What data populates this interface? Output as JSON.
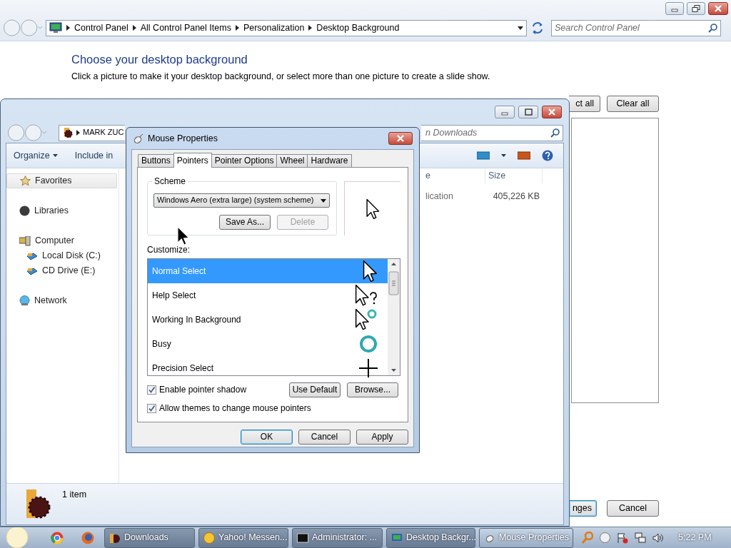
{
  "control_panel": {
    "breadcrumb": [
      "Control Panel",
      "All Control Panel Items",
      "Personalization",
      "Desktop Background"
    ],
    "search": {
      "placeholder": "Search Control Panel"
    },
    "heading": "Choose your desktop background",
    "description": "Click a picture to make it your desktop background, or select more than one picture to create a slide show.",
    "top_buttons": [
      "ct all",
      "Clear all"
    ],
    "bottom_buttons": [
      {
        "label": "nges",
        "default": true
      },
      {
        "label": "Cancel",
        "default": false
      }
    ]
  },
  "explorer": {
    "breadcrumb": [
      "MARK ZUC"
    ],
    "search": {
      "placeholder": "n Downloads"
    },
    "toolbar": [
      "Organize",
      "Include in"
    ],
    "nav": [
      {
        "label": "Favorites",
        "selected": true
      },
      {
        "label": "Libraries",
        "selected": false
      },
      {
        "label": "Computer",
        "selected": false,
        "children": [
          {
            "label": "Local Disk (C:)",
            "selected": false
          },
          {
            "label": "CD Drive (E:)",
            "selected": false
          }
        ]
      },
      {
        "label": "Network",
        "selected": false
      }
    ],
    "columns": [
      "e",
      "Size"
    ],
    "rows": [
      [
        "lication",
        "405,226 KB"
      ]
    ],
    "status": "1 item"
  },
  "dialog": {
    "title": "Mouse Properties",
    "tabs": [
      {
        "label": "Buttons",
        "selected": false
      },
      {
        "label": "Pointers",
        "selected": true
      },
      {
        "label": "Pointer Options",
        "selected": false
      },
      {
        "label": "Wheel",
        "selected": false
      },
      {
        "label": "Hardware",
        "selected": false
      }
    ],
    "scheme": {
      "label": "Scheme",
      "value": "Windows Aero (extra large) (system scheme)",
      "buttons": [
        {
          "label": "Save As...",
          "disabled": false
        },
        {
          "label": "Delete",
          "disabled": true
        }
      ]
    },
    "customize_label": "Customize:",
    "pointers": [
      {
        "label": "Normal Select",
        "kind": "arrow",
        "selected": true
      },
      {
        "label": "Help Select",
        "kind": "help",
        "selected": false
      },
      {
        "label": "Working In Background",
        "kind": "working",
        "selected": false
      },
      {
        "label": "Busy",
        "kind": "busy",
        "selected": false
      },
      {
        "label": "Precision Select",
        "kind": "precision",
        "selected": false
      }
    ],
    "checkboxes": [
      {
        "label": "Enable pointer shadow",
        "checked": true
      },
      {
        "label": "Allow themes to change mouse pointers",
        "checked": true
      }
    ],
    "side_buttons": [
      "Use Default",
      "Browse..."
    ],
    "buttons": [
      {
        "label": "OK",
        "default": true
      },
      {
        "label": "Cancel",
        "default": false
      },
      {
        "label": "Apply",
        "default": false
      }
    ]
  },
  "taskbar": {
    "items": [
      {
        "label": "Downloads",
        "selected": false
      },
      {
        "label": "Yahoo! Messen...",
        "selected": false
      },
      {
        "label": "Administrator: ...",
        "selected": false
      },
      {
        "label": "Desktop Backgr...",
        "selected": false
      },
      {
        "label": "Mouse Properties",
        "selected": true
      }
    ],
    "clock": "5:22 PM"
  }
}
